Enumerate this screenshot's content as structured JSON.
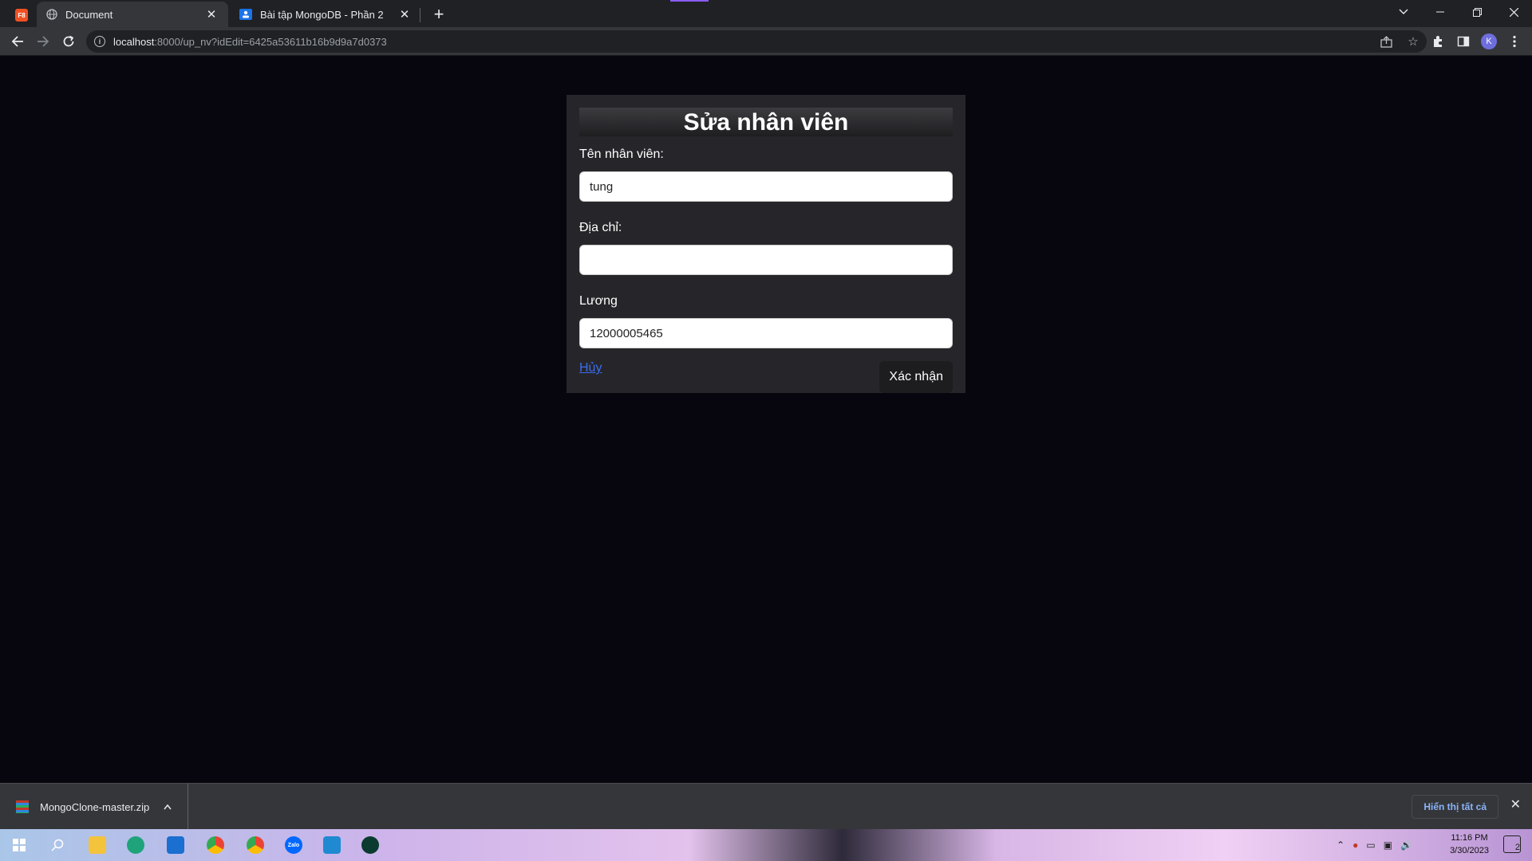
{
  "browser": {
    "tabs": [
      {
        "title": "Document",
        "active": true,
        "icon": "globe-icon"
      },
      {
        "title": "Bài tập MongoDB - Phần 2",
        "active": false,
        "icon": "classroom-icon"
      }
    ],
    "pinned_tab_label": "F8",
    "url_host": "localhost",
    "url_rest": ":8000/up_nv?idEdit=6425a53611b16b9d9a7d0373",
    "profile_initial": "K"
  },
  "form": {
    "title": "Sửa nhân viên",
    "fields": [
      {
        "label": "Tên nhân viên:",
        "value": "tung"
      },
      {
        "label": "Địa chỉ:",
        "value": ""
      },
      {
        "label": "Lương",
        "value": "12000005465"
      }
    ],
    "cancel_label": "Hủy",
    "submit_label": "Xác nhận"
  },
  "downloads": {
    "file_name": "MongoClone-master.zip",
    "show_all_label": "Hiển thị tất cả"
  },
  "taskbar": {
    "time": "11:16 PM",
    "date": "3/30/2023",
    "notification_count": "2",
    "zalo_label": "Zalo"
  },
  "colors": {
    "page_background": "#07060f",
    "card_background": "#26262a",
    "link": "#3b6cf0"
  }
}
